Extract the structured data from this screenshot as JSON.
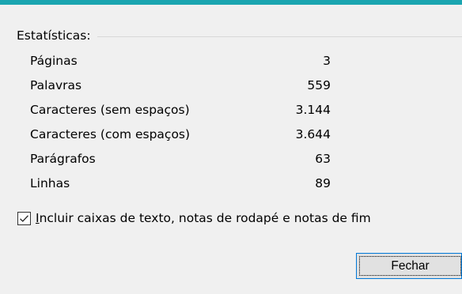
{
  "dialog": {
    "accent_color": "#1aa5b0",
    "stats_group_title": "Estatísticas:",
    "stats": [
      {
        "label": "Páginas",
        "value": "3"
      },
      {
        "label": "Palavras",
        "value": "559"
      },
      {
        "label": "Caracteres (sem espaços)",
        "value": "3.144"
      },
      {
        "label": "Caracteres (com espaços)",
        "value": "3.644"
      },
      {
        "label": "Parágrafos",
        "value": "63"
      },
      {
        "label": "Linhas",
        "value": "89"
      }
    ],
    "include_checkbox": {
      "checked": true,
      "mnemonic": "I",
      "label_rest": "ncluir caixas de texto, notas de rodapé e notas de fim"
    },
    "close_button_label": "Fechar"
  }
}
